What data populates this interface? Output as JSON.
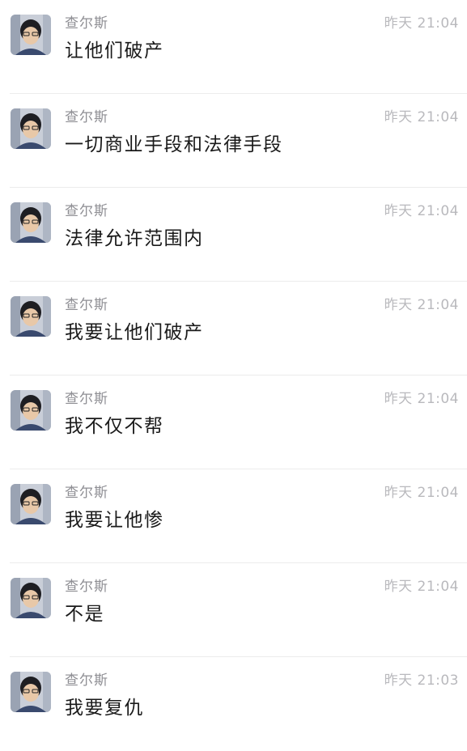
{
  "chat": {
    "messages": [
      {
        "sender": "查尔斯",
        "time": "昨天 21:04",
        "text": "让他们破产"
      },
      {
        "sender": "查尔斯",
        "time": "昨天 21:04",
        "text": "一切商业手段和法律手段"
      },
      {
        "sender": "查尔斯",
        "time": "昨天 21:04",
        "text": "法律允许范围内"
      },
      {
        "sender": "查尔斯",
        "time": "昨天 21:04",
        "text": "我要让他们破产"
      },
      {
        "sender": "查尔斯",
        "time": "昨天 21:04",
        "text": "我不仅不帮"
      },
      {
        "sender": "查尔斯",
        "time": "昨天 21:04",
        "text": "我要让他惨"
      },
      {
        "sender": "查尔斯",
        "time": "昨天 21:04",
        "text": "不是"
      },
      {
        "sender": "查尔斯",
        "time": "昨天 21:03",
        "text": "我要复仇"
      }
    ]
  }
}
